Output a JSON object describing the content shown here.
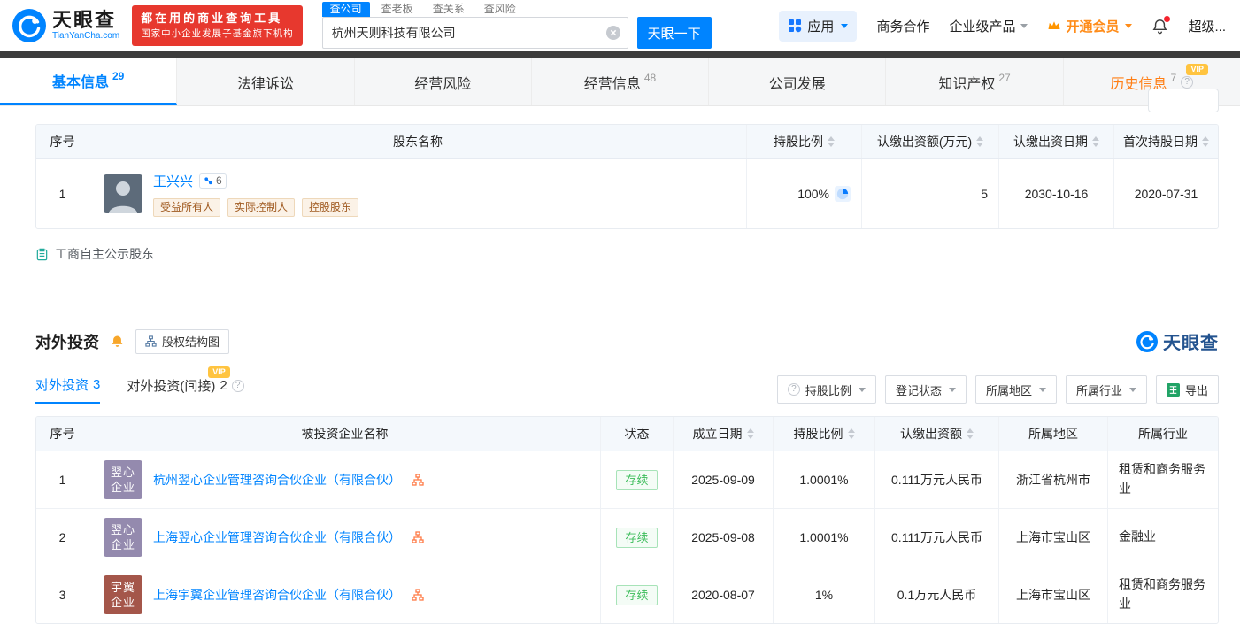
{
  "colors": {
    "brand_blue": "#0084ff",
    "promo_red": "#e7382e",
    "dark_strip": "#3c3c3c",
    "history_orange": "#ff7e14",
    "vip_gold": "#ffc440",
    "member_orange": "#ff8c19",
    "status_green": "#3dbd5b",
    "excel_green": "#21a366",
    "equity_orange": "#ff7a45",
    "watermark_blue": "#23538f",
    "tag_text": "#a05a20"
  },
  "misc": {
    "vip_label": "VIP",
    "help": "?"
  },
  "header": {
    "logo_text": "天眼查",
    "logo_sub": "TianYanCha.com",
    "promo_line1": "都在用的商业查询工具",
    "promo_line2": "国家中小企业发展子基金旗下机构",
    "search_tabs": [
      {
        "label": "查公司",
        "active": true
      },
      {
        "label": "查老板",
        "active": false
      },
      {
        "label": "查关系",
        "active": false
      },
      {
        "label": "查风险",
        "active": false
      }
    ],
    "search_value": "杭州天则科技有限公司",
    "search_button": "天眼一下",
    "nav": {
      "apps": "应用",
      "cooperation": "商务合作",
      "enterprise": "企业级产品",
      "vip": "开通会员",
      "super": "超级..."
    }
  },
  "tabs": [
    {
      "label": "基本信息",
      "count": "29",
      "active": true
    },
    {
      "label": "法律诉讼",
      "count": ""
    },
    {
      "label": "经营风险",
      "count": ""
    },
    {
      "label": "经营信息",
      "count": "48"
    },
    {
      "label": "公司发展",
      "count": ""
    },
    {
      "label": "知识产权",
      "count": "27"
    },
    {
      "label": "历史信息",
      "count": "7",
      "vip": true
    }
  ],
  "shareholders": {
    "columns": [
      "序号",
      "股东名称",
      "持股比例",
      "认缴出资额(万元)",
      "认缴出资日期",
      "首次持股日期"
    ],
    "rows": [
      {
        "index": "1",
        "name": "王兴兴",
        "badge_count": "6",
        "tags": [
          "受益所有人",
          "实际控制人",
          "控股股东"
        ],
        "ratio": "100%",
        "amount": "5",
        "date": "2030-10-16",
        "first_date": "2020-07-31"
      }
    ],
    "footer_link": "工商自主公示股东"
  },
  "investment": {
    "title": "对外投资",
    "structure_button": "股权结构图",
    "brand": "天眼查",
    "subtabs": [
      {
        "label": "对外投资",
        "count": "3",
        "active": true
      },
      {
        "label": "对外投资(间接)",
        "count": "2",
        "vip": true
      }
    ],
    "filters": [
      "持股比例",
      "登记状态",
      "所属地区",
      "所属行业"
    ],
    "export_label": "导出",
    "columns": [
      "序号",
      "被投资企业名称",
      "状态",
      "成立日期",
      "持股比例",
      "认缴出资额",
      "所属地区",
      "所属行业"
    ],
    "rows": [
      {
        "index": "1",
        "logo_text": "翌心企业",
        "logo_color": "#948aae",
        "name": "杭州翌心企业管理咨询合伙企业（有限合伙）",
        "status": "存续",
        "date": "2025-09-09",
        "ratio": "1.0001%",
        "amount": "0.111万元人民币",
        "region": "浙江省杭州市",
        "industry": "租赁和商务服务业"
      },
      {
        "index": "2",
        "logo_text": "翌心企业",
        "logo_color": "#948aae",
        "name": "上海翌心企业管理咨询合伙企业（有限合伙）",
        "status": "存续",
        "date": "2025-09-08",
        "ratio": "1.0001%",
        "amount": "0.111万元人民币",
        "region": "上海市宝山区",
        "industry": "金融业"
      },
      {
        "index": "3",
        "logo_text": "宇翼企业",
        "logo_color": "#a4564a",
        "name": "上海宇翼企业管理咨询合伙企业（有限合伙）",
        "status": "存续",
        "date": "2020-08-07",
        "ratio": "1%",
        "amount": "0.1万元人民币",
        "region": "上海市宝山区",
        "industry": "租赁和商务服务业"
      }
    ]
  }
}
